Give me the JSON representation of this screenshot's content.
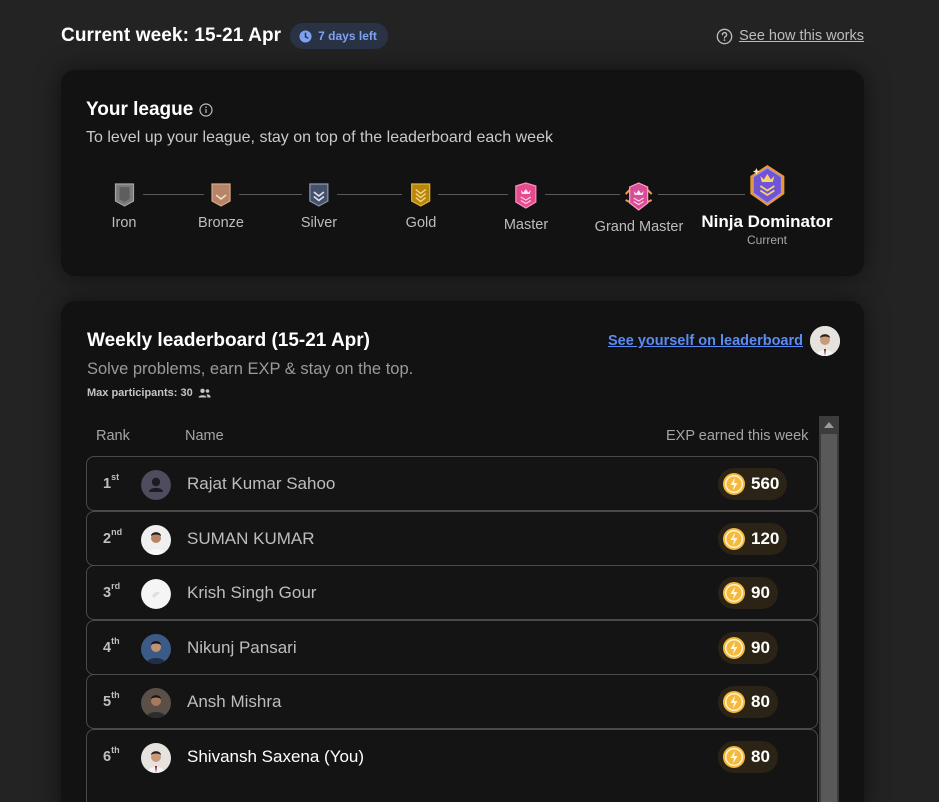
{
  "header": {
    "week_title": "Current week: 15-21 Apr",
    "days_left": "7 days left",
    "how_it_works": "See how this works"
  },
  "league": {
    "title": "Your league",
    "subtitle": "To level up your league, stay on top of the leaderboard each week",
    "tiers": [
      {
        "name": "Iron",
        "color": "#8a8a8a"
      },
      {
        "name": "Bronze",
        "color": "#b78468"
      },
      {
        "name": "Silver",
        "color": "#7b8aa3"
      },
      {
        "name": "Gold",
        "color": "#c79a2c"
      },
      {
        "name": "Master",
        "color": "#e8508f"
      },
      {
        "name": "Grand Master",
        "color": "#d85a9a"
      },
      {
        "name": "Ninja Dominator",
        "color": "#8a6ee8"
      }
    ],
    "current_label": "Current"
  },
  "leaderboard": {
    "title": "Weekly leaderboard (15-21 Apr)",
    "subtitle": "Solve problems, earn EXP & stay on the top.",
    "max_participants": "Max participants: 30",
    "see_yourself": "See yourself on leaderboard",
    "columns": {
      "rank": "Rank",
      "name": "Name",
      "exp": "EXP earned this week"
    },
    "rows": [
      {
        "rank": "1",
        "suffix": "st",
        "name": "Rajat Kumar Sahoo",
        "exp": "560"
      },
      {
        "rank": "2",
        "suffix": "nd",
        "name": "SUMAN KUMAR",
        "exp": "120"
      },
      {
        "rank": "3",
        "suffix": "rd",
        "name": "Krish Singh Gour",
        "exp": "90"
      },
      {
        "rank": "4",
        "suffix": "th",
        "name": "Nikunj Pansari",
        "exp": "90"
      },
      {
        "rank": "5",
        "suffix": "th",
        "name": "Ansh Mishra",
        "exp": "80"
      },
      {
        "rank": "6",
        "suffix": "th",
        "name": "Shivansh Saxena (You)",
        "exp": "80"
      }
    ]
  },
  "colors": {
    "accent_link": "#5b8cf5",
    "badge_text": "#7fa2f0",
    "exp_bolt": "#f5b93b"
  }
}
